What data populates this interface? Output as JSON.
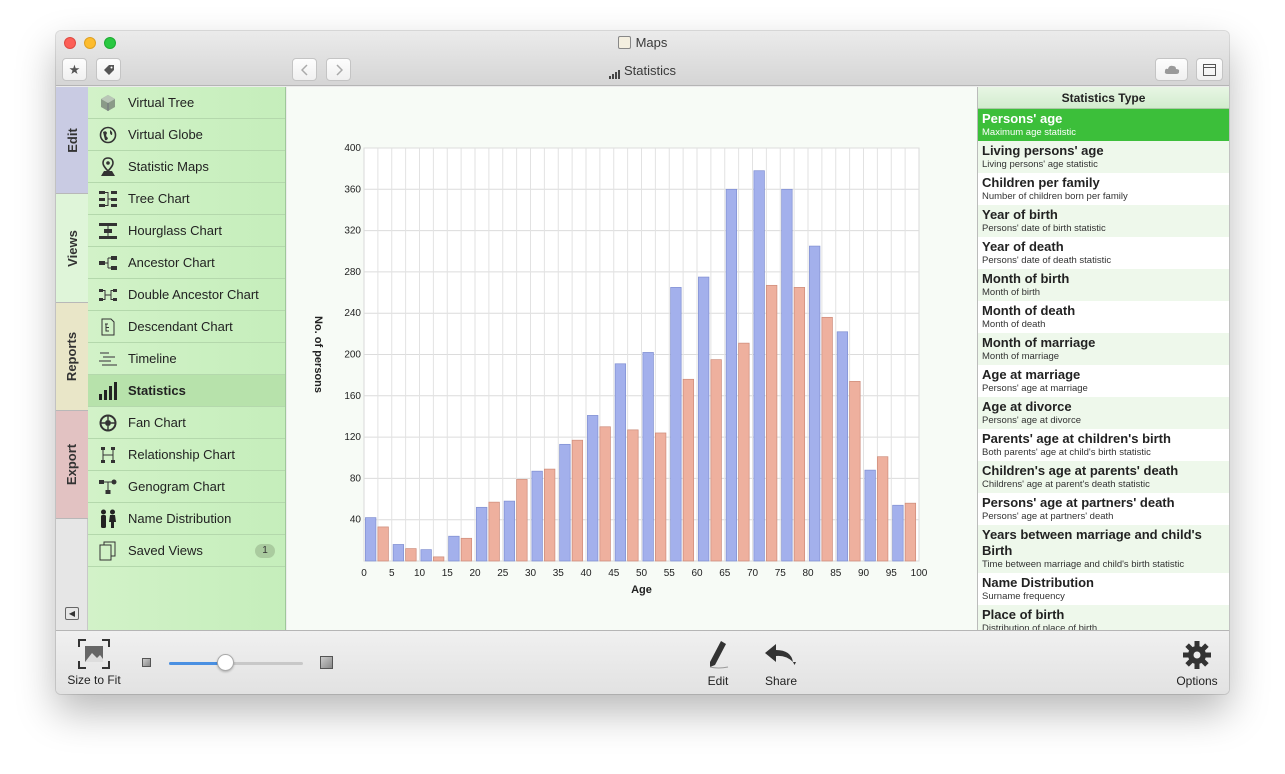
{
  "window": {
    "title": "Maps",
    "view_title": "Statistics"
  },
  "vertical_tabs": [
    "Edit",
    "Views",
    "Reports",
    "Export"
  ],
  "sidebar": {
    "items": [
      {
        "label": "Virtual Tree",
        "icon": "cube-icon"
      },
      {
        "label": "Virtual Globe",
        "icon": "globe-icon"
      },
      {
        "label": "Statistic Maps",
        "icon": "map-pin-icon"
      },
      {
        "label": "Tree Chart",
        "icon": "tree-chart-icon"
      },
      {
        "label": "Hourglass Chart",
        "icon": "hourglass-chart-icon"
      },
      {
        "label": "Ancestor Chart",
        "icon": "ancestor-chart-icon"
      },
      {
        "label": "Double Ancestor Chart",
        "icon": "double-ancestor-chart-icon"
      },
      {
        "label": "Descendant Chart",
        "icon": "descendant-chart-icon"
      },
      {
        "label": "Timeline",
        "icon": "timeline-icon"
      },
      {
        "label": "Statistics",
        "icon": "statistics-icon"
      },
      {
        "label": "Fan Chart",
        "icon": "fan-chart-icon"
      },
      {
        "label": "Relationship Chart",
        "icon": "relationship-chart-icon"
      },
      {
        "label": "Genogram Chart",
        "icon": "genogram-chart-icon"
      },
      {
        "label": "Name Distribution",
        "icon": "name-distribution-icon"
      },
      {
        "label": "Saved Views",
        "icon": "saved-views-icon",
        "badge": "1"
      }
    ],
    "active_index": 9
  },
  "stats_panel": {
    "header": "Statistics Type",
    "items": [
      {
        "title": "Persons' age",
        "desc": "Maximum age statistic"
      },
      {
        "title": "Living persons' age",
        "desc": "Living persons' age statistic"
      },
      {
        "title": "Children per family",
        "desc": "Number of children born per family"
      },
      {
        "title": "Year of birth",
        "desc": "Persons' date of birth statistic"
      },
      {
        "title": "Year of death",
        "desc": "Persons' date of death statistic"
      },
      {
        "title": "Month of birth",
        "desc": "Month of birth"
      },
      {
        "title": "Month of death",
        "desc": "Month of death"
      },
      {
        "title": "Month of marriage",
        "desc": "Month of marriage"
      },
      {
        "title": "Age at marriage",
        "desc": "Persons' age at marriage"
      },
      {
        "title": "Age at divorce",
        "desc": "Persons' age at divorce"
      },
      {
        "title": "Parents' age at children's birth",
        "desc": "Both parents' age at child's birth statistic"
      },
      {
        "title": "Children's age at parents' death",
        "desc": "Childrens' age at parent's death statistic"
      },
      {
        "title": "Persons' age at partners' death",
        "desc": "Persons' age at partners' death"
      },
      {
        "title": "Years between marriage and child's Birth",
        "desc": "Time between marriage and child's birth statistic"
      },
      {
        "title": "Name Distribution",
        "desc": "Surname frequency"
      },
      {
        "title": "Place of birth",
        "desc": "Distribution of place of birth"
      }
    ],
    "selected_index": 0
  },
  "bottombar": {
    "size_to_fit": "Size to Fit",
    "edit": "Edit",
    "share": "Share",
    "options": "Options",
    "zoom_fraction": 0.42
  },
  "chart_data": {
    "type": "bar",
    "xlabel": "Age",
    "ylabel": "No. of persons",
    "ylim": [
      0,
      400
    ],
    "yticks": [
      40,
      80,
      120,
      160,
      200,
      240,
      280,
      320,
      360,
      400
    ],
    "categories": [
      0,
      5,
      10,
      15,
      20,
      25,
      30,
      35,
      40,
      45,
      50,
      55,
      60,
      65,
      70,
      75,
      80,
      85,
      90,
      95,
      100
    ],
    "grid": true,
    "colors": [
      "#a3b0ec",
      "#eeb09e"
    ],
    "series": [
      {
        "values": [
          42,
          16,
          11,
          24,
          52,
          58,
          87,
          113,
          141,
          191,
          202,
          265,
          275,
          360,
          378,
          360,
          305,
          222,
          88,
          54
        ]
      },
      {
        "values": [
          33,
          12,
          4,
          22,
          57,
          79,
          89,
          117,
          130,
          127,
          124,
          176,
          195,
          211,
          267,
          265,
          236,
          174,
          101,
          56
        ]
      }
    ]
  }
}
